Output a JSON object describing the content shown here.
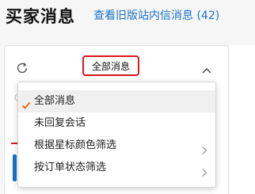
{
  "header": {
    "title": "买家消息",
    "old_site_link": "查看旧版站内信消息 (42)"
  },
  "filter": {
    "selected_label": "全部消息"
  },
  "menu": {
    "items": [
      {
        "label": "全部消息",
        "selected": true,
        "has_submenu": false
      },
      {
        "label": "未回复会话",
        "selected": false,
        "has_submenu": false
      },
      {
        "label": "根据星标颜色筛选",
        "selected": false,
        "has_submenu": true
      },
      {
        "label": "按订单状态筛选",
        "selected": false,
        "has_submenu": true
      }
    ]
  },
  "colors": {
    "link": "#1a73c8",
    "highlight_border": "#d9181e",
    "check": "#e8650e"
  },
  "icons": {
    "refresh": "refresh-icon",
    "collapse": "chevron-up-icon",
    "check": "check-icon",
    "submenu": "chevron-right-icon"
  }
}
